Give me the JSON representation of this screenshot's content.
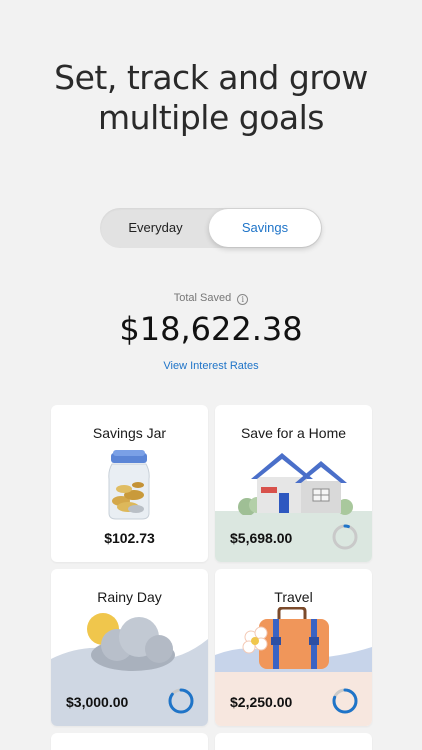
{
  "headline": {
    "line1": "Set, track and grow",
    "line2": "multiple goals"
  },
  "toggle": {
    "options": [
      "Everyday",
      "Savings"
    ],
    "selected": "Savings"
  },
  "summary": {
    "label": "Total Saved",
    "info_icon": "info-icon",
    "amount": "$18,622.38",
    "link": "View Interest Rates"
  },
  "goals": [
    {
      "title": "Savings Jar",
      "amount": "$102.73",
      "illustration": "jar-icon"
    },
    {
      "title": "Save for a Home",
      "amount": "$5,698.00",
      "illustration": "house-icon",
      "progress": 0.05
    },
    {
      "title": "Rainy Day",
      "amount": "$3,000.00",
      "illustration": "cloud-icon",
      "progress": 0.85
    },
    {
      "title": "Travel",
      "amount": "$2,250.00",
      "illustration": "suitcase-icon",
      "progress": 0.8
    }
  ],
  "colors": {
    "accent": "#1f74c8",
    "ring_track": "#c9c9c9",
    "home_band": "#dbe7e0",
    "rainy_band": "#cfd7e3",
    "travel_band": "#f7e7df"
  }
}
